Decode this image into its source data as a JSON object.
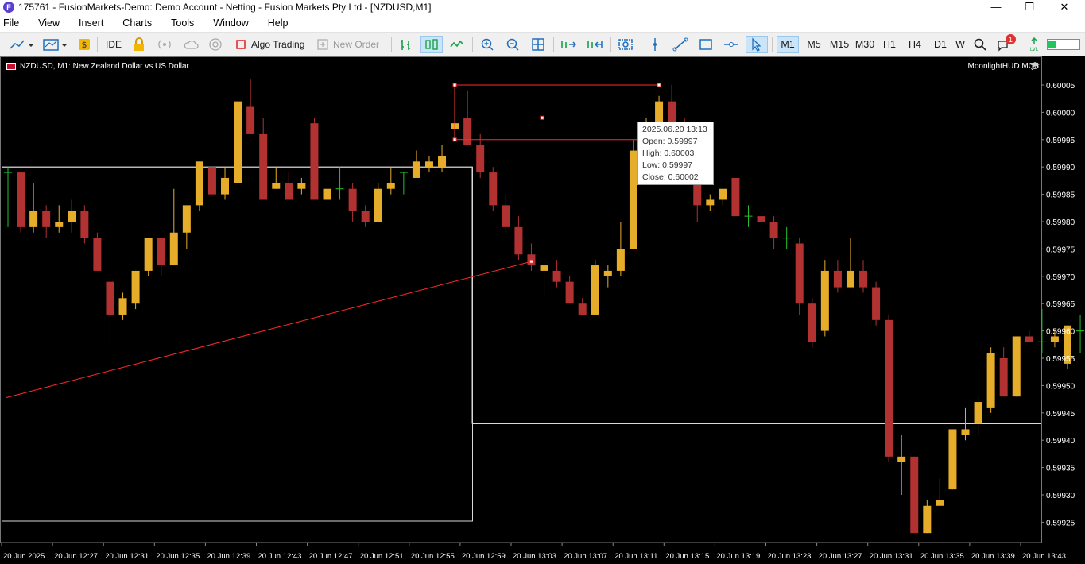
{
  "window": {
    "title": "175761 - FusionMarkets-Demo: Demo Account - Netting - Fusion Markets Pty Ltd - [NZDUSD,M1]",
    "icon_letter": "F",
    "minimize": "—",
    "maximize": "❐",
    "close": "✕"
  },
  "menu": [
    "File",
    "View",
    "Insert",
    "Charts",
    "Tools",
    "Window",
    "Help"
  ],
  "toolbar": {
    "ide_label": "IDE",
    "algo_trading_label": "Algo Trading",
    "new_order_label": "New Order",
    "timeframes": [
      "M1",
      "M5",
      "M15",
      "M30",
      "H1",
      "H4",
      "D1",
      "W"
    ],
    "selected_timeframe": "M1",
    "notification_count": "1",
    "icons": [
      "line-chart-icon",
      "chart-template-icon",
      "dollar-icon",
      "lock-icon",
      "signal-icon",
      "cloud-icon",
      "vps-icon",
      "algo-trading-icon",
      "new-order-icon",
      "bar-chart-icon",
      "candles-icon",
      "line-icon",
      "zoom-in-icon",
      "zoom-out-icon",
      "tile-icon",
      "scroll-icon",
      "shift-icon",
      "screenshot-icon",
      "crosshair-icon",
      "trendline-icon",
      "rectangle-icon",
      "hline-icon",
      "cursor-icon",
      "search-icon",
      "chat-icon",
      "signal-strength-icon"
    ]
  },
  "chart": {
    "symbol_label": "NZDUSD, M1:  New Zealand Dollar vs US Dollar",
    "indicator_label": "MoonlightHUD.MQ5",
    "bull_color": "#e6ad2a",
    "bear_color": "#b23131",
    "doji_color": "#25c22a",
    "background": "#000000",
    "annotation_color": "#ff2a2a",
    "box_color": "#d9d9d9"
  },
  "tooltip": {
    "time": "2025.06.20 13:13",
    "open": "Open: 0.59997",
    "high": "High: 0.60003",
    "low": "Low: 0.59997",
    "close": "Close: 0.60002"
  },
  "chart_data": {
    "type": "candlestick",
    "price_axis_labels": [
      "0.60005",
      "0.60000",
      "0.59995",
      "0.59990",
      "0.59985",
      "0.59980",
      "0.59975",
      "0.59970",
      "0.59965",
      "0.59960",
      "0.59955",
      "0.59950",
      "0.59945",
      "0.59940",
      "0.59935",
      "0.59930",
      "0.59925"
    ],
    "time_axis_labels": [
      "20 Jun 2025",
      "20 Jun 12:27",
      "20 Jun 12:31",
      "20 Jun 12:35",
      "20 Jun 12:39",
      "20 Jun 12:43",
      "20 Jun 12:47",
      "20 Jun 12:51",
      "20 Jun 12:55",
      "20 Jun 12:59",
      "20 Jun 13:03",
      "20 Jun 13:07",
      "20 Jun 13:11",
      "20 Jun 13:15",
      "20 Jun 13:19",
      "20 Jun 13:23",
      "20 Jun 13:27",
      "20 Jun 13:31",
      "20 Jun 13:35",
      "20 Jun 13:39",
      "20 Jun 13:43"
    ],
    "y_range": [
      0.59921,
      0.60009
    ],
    "candles": [
      [
        0.59989,
        0.5999,
        0.59979,
        0.59989
      ],
      [
        0.59989,
        0.59989,
        0.59978,
        0.59979
      ],
      [
        0.59979,
        0.59987,
        0.59978,
        0.59982
      ],
      [
        0.59982,
        0.59983,
        0.59977,
        0.59979
      ],
      [
        0.59979,
        0.59983,
        0.59978,
        0.5998
      ],
      [
        0.5998,
        0.59984,
        0.59978,
        0.59982
      ],
      [
        0.59982,
        0.59983,
        0.59976,
        0.59977
      ],
      [
        0.59977,
        0.59978,
        0.59971,
        0.59971
      ],
      [
        0.59969,
        0.59969,
        0.59957,
        0.59963
      ],
      [
        0.59963,
        0.59967,
        0.59962,
        0.59966
      ],
      [
        0.59965,
        0.59971,
        0.59964,
        0.59971
      ],
      [
        0.59971,
        0.59977,
        0.5997,
        0.59977
      ],
      [
        0.59977,
        0.59977,
        0.5997,
        0.59972
      ],
      [
        0.59972,
        0.59986,
        0.59972,
        0.59978
      ],
      [
        0.59978,
        0.59981,
        0.59975,
        0.59983
      ],
      [
        0.59983,
        0.59991,
        0.59982,
        0.59991
      ],
      [
        0.5999,
        0.5999,
        0.59985,
        0.59985
      ],
      [
        0.59985,
        0.5999,
        0.59984,
        0.59988
      ],
      [
        0.59987,
        0.60002,
        0.59987,
        0.60002
      ],
      [
        0.60001,
        0.60006,
        0.59996,
        0.59996
      ],
      [
        0.59996,
        0.59999,
        0.59984,
        0.59984
      ],
      [
        0.59986,
        0.5999,
        0.59986,
        0.59987
      ],
      [
        0.59987,
        0.59989,
        0.59985,
        0.59984
      ],
      [
        0.59986,
        0.59988,
        0.59985,
        0.59987
      ],
      [
        0.59998,
        0.59999,
        0.59984,
        0.59984
      ],
      [
        0.59984,
        0.59989,
        0.59983,
        0.59986
      ],
      [
        0.59986,
        0.5999,
        0.59984,
        0.59986
      ],
      [
        0.59986,
        0.59987,
        0.5998,
        0.59982
      ],
      [
        0.59982,
        0.59983,
        0.59979,
        0.5998
      ],
      [
        0.5998,
        0.59987,
        0.5998,
        0.59986
      ],
      [
        0.59986,
        0.5999,
        0.59985,
        0.59987
      ],
      [
        0.59989,
        0.59989,
        0.59985,
        0.59989
      ],
      [
        0.59988,
        0.59993,
        0.59988,
        0.59991
      ],
      [
        0.5999,
        0.59992,
        0.59989,
        0.59991
      ],
      [
        0.5999,
        0.59994,
        0.59989,
        0.59992
      ],
      [
        0.59997,
        0.60005,
        0.59995,
        0.59998
      ],
      [
        0.59999,
        0.60004,
        0.59994,
        0.59994
      ],
      [
        0.59994,
        0.59996,
        0.59988,
        0.59989
      ],
      [
        0.59989,
        0.5999,
        0.59982,
        0.59983
      ],
      [
        0.59983,
        0.59985,
        0.59978,
        0.59979
      ],
      [
        0.59979,
        0.59981,
        0.59973,
        0.59974
      ],
      [
        0.59974,
        0.59976,
        0.59971,
        0.59972
      ],
      [
        0.59971,
        0.59973,
        0.59966,
        0.59972
      ],
      [
        0.59971,
        0.59973,
        0.59968,
        0.59969
      ],
      [
        0.59969,
        0.5997,
        0.59965,
        0.59965
      ],
      [
        0.59965,
        0.59966,
        0.59963,
        0.59963
      ],
      [
        0.59963,
        0.59973,
        0.59963,
        0.59972
      ],
      [
        0.5997,
        0.59972,
        0.59968,
        0.59971
      ],
      [
        0.59971,
        0.5998,
        0.5997,
        0.59975
      ],
      [
        0.59975,
        0.59995,
        0.59975,
        0.59993
      ],
      [
        0.59994,
        0.59999,
        0.59993,
        0.59997
      ],
      [
        0.59997,
        0.60003,
        0.59997,
        0.60002
      ],
      [
        0.60002,
        0.60005,
        0.59996,
        0.59998
      ],
      [
        0.59998,
        0.59999,
        0.5999,
        0.59991
      ],
      [
        0.59991,
        0.59992,
        0.5998,
        0.59983
      ],
      [
        0.59983,
        0.59985,
        0.59982,
        0.59984
      ],
      [
        0.59984,
        0.59986,
        0.59983,
        0.59986
      ],
      [
        0.59988,
        0.59988,
        0.59981,
        0.59981
      ],
      [
        0.59981,
        0.59983,
        0.59979,
        0.59981
      ],
      [
        0.59981,
        0.59982,
        0.59978,
        0.5998
      ],
      [
        0.5998,
        0.59981,
        0.59975,
        0.59977
      ],
      [
        0.59977,
        0.59979,
        0.59975,
        0.59977
      ],
      [
        0.59976,
        0.59977,
        0.59963,
        0.59965
      ],
      [
        0.59965,
        0.59966,
        0.59957,
        0.59958
      ],
      [
        0.5996,
        0.59973,
        0.59959,
        0.59971
      ],
      [
        0.59971,
        0.59973,
        0.59967,
        0.59968
      ],
      [
        0.59968,
        0.59977,
        0.59968,
        0.59971
      ],
      [
        0.59971,
        0.59973,
        0.59967,
        0.59968
      ],
      [
        0.59968,
        0.59969,
        0.59961,
        0.59962
      ],
      [
        0.59962,
        0.59963,
        0.59936,
        0.59937
      ],
      [
        0.59936,
        0.59941,
        0.5993,
        0.59937
      ],
      [
        0.59937,
        0.59937,
        0.59923,
        0.59923
      ],
      [
        0.59923,
        0.59929,
        0.59923,
        0.59928
      ],
      [
        0.59928,
        0.59933,
        0.59928,
        0.59929
      ],
      [
        0.59931,
        0.59942,
        0.59931,
        0.59942
      ],
      [
        0.59941,
        0.59946,
        0.5994,
        0.59942
      ],
      [
        0.59943,
        0.59948,
        0.59941,
        0.59947
      ],
      [
        0.59946,
        0.59957,
        0.59945,
        0.59956
      ],
      [
        0.59955,
        0.59957,
        0.59948,
        0.59948
      ],
      [
        0.59948,
        0.59959,
        0.59948,
        0.59959
      ],
      [
        0.59959,
        0.5996,
        0.59958,
        0.59958
      ],
      [
        0.59958,
        0.59964,
        0.59956,
        0.59958
      ],
      [
        0.59958,
        0.5996,
        0.59957,
        0.59959
      ],
      [
        0.59954,
        0.59961,
        0.59953,
        0.59961
      ],
      [
        0.5996,
        0.59963,
        0.59956,
        0.5996
      ]
    ],
    "horizontal_lines": [
      0.5999,
      0.59943
    ],
    "trend_line": {
      "from": [
        0,
        0.59951
      ],
      "to": [
        41,
        0.59973
      ]
    },
    "range_box": {
      "from": [
        35,
        0.60005
      ],
      "to": [
        51,
        0.60005
      ],
      "bottom": 0.59995
    },
    "marker": 0.59999
  }
}
